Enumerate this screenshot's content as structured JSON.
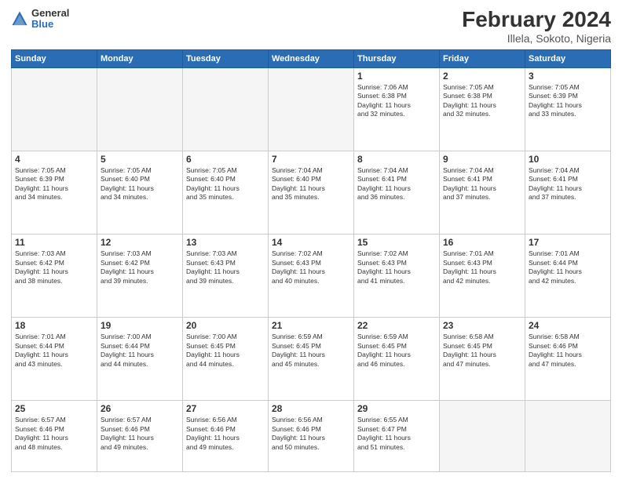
{
  "logo": {
    "general": "General",
    "blue": "Blue"
  },
  "header": {
    "title": "February 2024",
    "subtitle": "Illela, Sokoto, Nigeria"
  },
  "days": [
    "Sunday",
    "Monday",
    "Tuesday",
    "Wednesday",
    "Thursday",
    "Friday",
    "Saturday"
  ],
  "weeks": [
    [
      {
        "date": "",
        "info": ""
      },
      {
        "date": "",
        "info": ""
      },
      {
        "date": "",
        "info": ""
      },
      {
        "date": "",
        "info": ""
      },
      {
        "date": "1",
        "info": "Sunrise: 7:06 AM\nSunset: 6:38 PM\nDaylight: 11 hours\nand 32 minutes."
      },
      {
        "date": "2",
        "info": "Sunrise: 7:05 AM\nSunset: 6:38 PM\nDaylight: 11 hours\nand 32 minutes."
      },
      {
        "date": "3",
        "info": "Sunrise: 7:05 AM\nSunset: 6:39 PM\nDaylight: 11 hours\nand 33 minutes."
      }
    ],
    [
      {
        "date": "4",
        "info": "Sunrise: 7:05 AM\nSunset: 6:39 PM\nDaylight: 11 hours\nand 34 minutes."
      },
      {
        "date": "5",
        "info": "Sunrise: 7:05 AM\nSunset: 6:40 PM\nDaylight: 11 hours\nand 34 minutes."
      },
      {
        "date": "6",
        "info": "Sunrise: 7:05 AM\nSunset: 6:40 PM\nDaylight: 11 hours\nand 35 minutes."
      },
      {
        "date": "7",
        "info": "Sunrise: 7:04 AM\nSunset: 6:40 PM\nDaylight: 11 hours\nand 35 minutes."
      },
      {
        "date": "8",
        "info": "Sunrise: 7:04 AM\nSunset: 6:41 PM\nDaylight: 11 hours\nand 36 minutes."
      },
      {
        "date": "9",
        "info": "Sunrise: 7:04 AM\nSunset: 6:41 PM\nDaylight: 11 hours\nand 37 minutes."
      },
      {
        "date": "10",
        "info": "Sunrise: 7:04 AM\nSunset: 6:41 PM\nDaylight: 11 hours\nand 37 minutes."
      }
    ],
    [
      {
        "date": "11",
        "info": "Sunrise: 7:03 AM\nSunset: 6:42 PM\nDaylight: 11 hours\nand 38 minutes."
      },
      {
        "date": "12",
        "info": "Sunrise: 7:03 AM\nSunset: 6:42 PM\nDaylight: 11 hours\nand 39 minutes."
      },
      {
        "date": "13",
        "info": "Sunrise: 7:03 AM\nSunset: 6:43 PM\nDaylight: 11 hours\nand 39 minutes."
      },
      {
        "date": "14",
        "info": "Sunrise: 7:02 AM\nSunset: 6:43 PM\nDaylight: 11 hours\nand 40 minutes."
      },
      {
        "date": "15",
        "info": "Sunrise: 7:02 AM\nSunset: 6:43 PM\nDaylight: 11 hours\nand 41 minutes."
      },
      {
        "date": "16",
        "info": "Sunrise: 7:01 AM\nSunset: 6:43 PM\nDaylight: 11 hours\nand 42 minutes."
      },
      {
        "date": "17",
        "info": "Sunrise: 7:01 AM\nSunset: 6:44 PM\nDaylight: 11 hours\nand 42 minutes."
      }
    ],
    [
      {
        "date": "18",
        "info": "Sunrise: 7:01 AM\nSunset: 6:44 PM\nDaylight: 11 hours\nand 43 minutes."
      },
      {
        "date": "19",
        "info": "Sunrise: 7:00 AM\nSunset: 6:44 PM\nDaylight: 11 hours\nand 44 minutes."
      },
      {
        "date": "20",
        "info": "Sunrise: 7:00 AM\nSunset: 6:45 PM\nDaylight: 11 hours\nand 44 minutes."
      },
      {
        "date": "21",
        "info": "Sunrise: 6:59 AM\nSunset: 6:45 PM\nDaylight: 11 hours\nand 45 minutes."
      },
      {
        "date": "22",
        "info": "Sunrise: 6:59 AM\nSunset: 6:45 PM\nDaylight: 11 hours\nand 46 minutes."
      },
      {
        "date": "23",
        "info": "Sunrise: 6:58 AM\nSunset: 6:45 PM\nDaylight: 11 hours\nand 47 minutes."
      },
      {
        "date": "24",
        "info": "Sunrise: 6:58 AM\nSunset: 6:46 PM\nDaylight: 11 hours\nand 47 minutes."
      }
    ],
    [
      {
        "date": "25",
        "info": "Sunrise: 6:57 AM\nSunset: 6:46 PM\nDaylight: 11 hours\nand 48 minutes."
      },
      {
        "date": "26",
        "info": "Sunrise: 6:57 AM\nSunset: 6:46 PM\nDaylight: 11 hours\nand 49 minutes."
      },
      {
        "date": "27",
        "info": "Sunrise: 6:56 AM\nSunset: 6:46 PM\nDaylight: 11 hours\nand 49 minutes."
      },
      {
        "date": "28",
        "info": "Sunrise: 6:56 AM\nSunset: 6:46 PM\nDaylight: 11 hours\nand 50 minutes."
      },
      {
        "date": "29",
        "info": "Sunrise: 6:55 AM\nSunset: 6:47 PM\nDaylight: 11 hours\nand 51 minutes."
      },
      {
        "date": "",
        "info": ""
      },
      {
        "date": "",
        "info": ""
      }
    ]
  ]
}
